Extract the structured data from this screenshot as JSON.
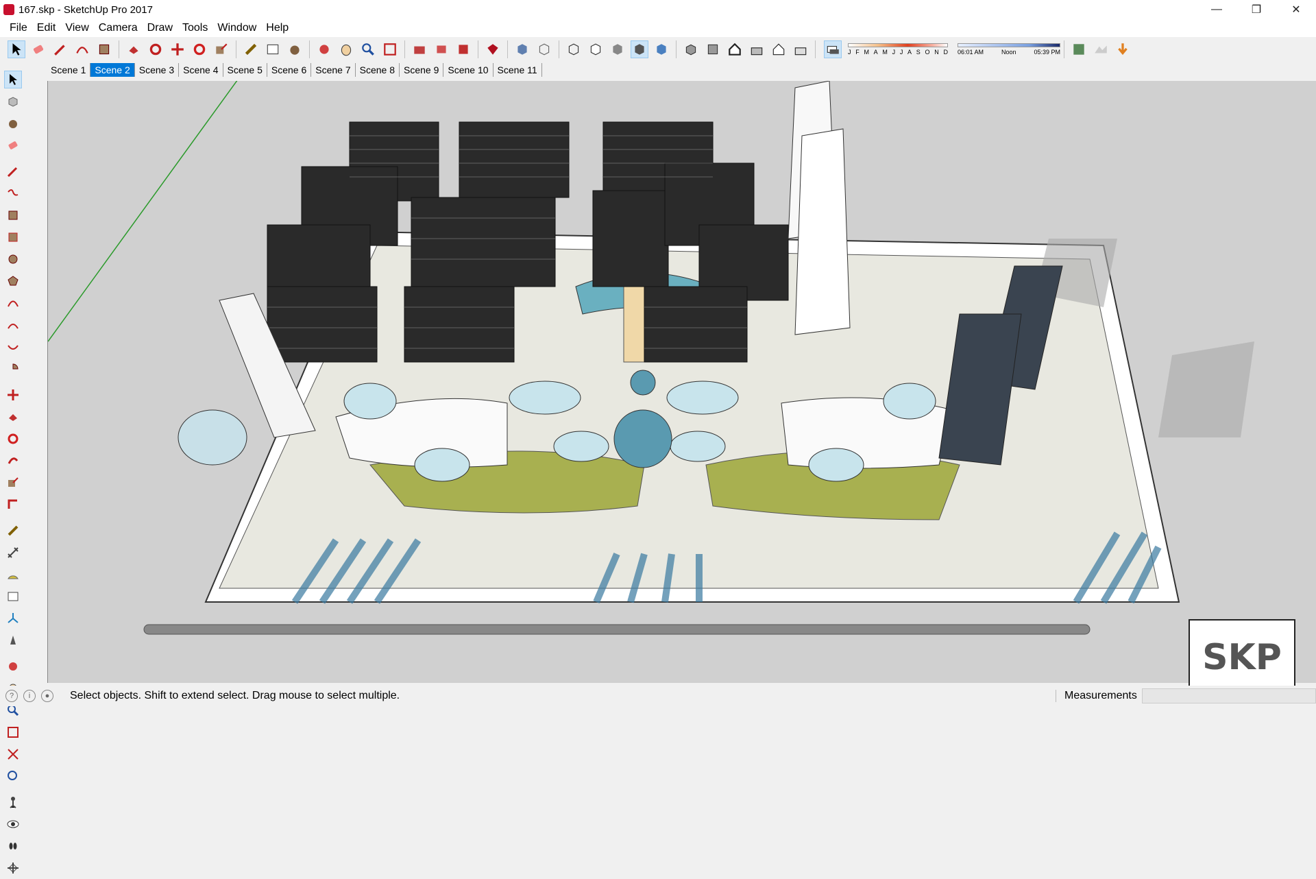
{
  "window": {
    "title": "167.skp - SketchUp Pro 2017",
    "minimize": "—",
    "restore": "❐",
    "close": "✕"
  },
  "menu": [
    "File",
    "Edit",
    "View",
    "Camera",
    "Draw",
    "Tools",
    "Window",
    "Help"
  ],
  "shadow": {
    "months": [
      "J",
      "F",
      "M",
      "A",
      "M",
      "J",
      "J",
      "A",
      "S",
      "O",
      "N",
      "D"
    ],
    "times": [
      "06:01 AM",
      "Noon",
      "05:39 PM"
    ]
  },
  "scenes": [
    "Scene 1",
    "Scene 2",
    "Scene 3",
    "Scene 4",
    "Scene 5",
    "Scene 6",
    "Scene 7",
    "Scene 8",
    "Scene 9",
    "Scene 10",
    "Scene 11"
  ],
  "active_scene": "Scene 2",
  "status": {
    "message": "Select objects. Shift to extend select. Drag mouse to select multiple.",
    "measurements_label": "Measurements",
    "measurements_value": ""
  },
  "logo": {
    "text": "SKP"
  },
  "colors": {
    "accent": "#0078d7",
    "viewport_bg": "#d0d0d0"
  }
}
